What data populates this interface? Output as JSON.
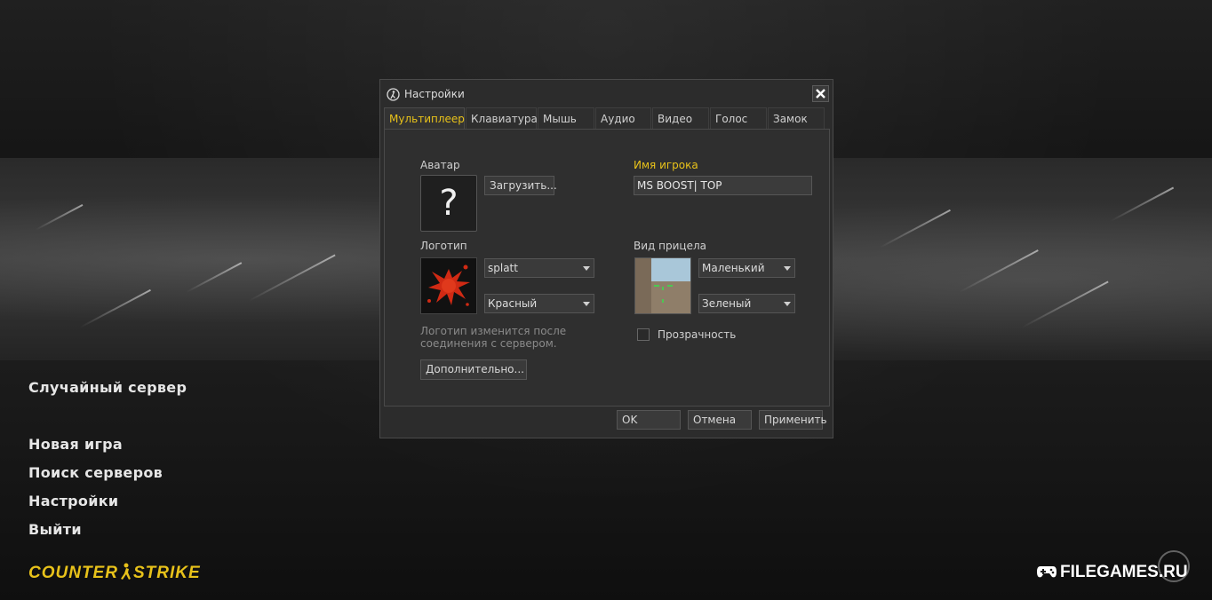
{
  "main_menu": {
    "items": [
      "Случайный сервер",
      "Новая игра",
      "Поиск серверов",
      "Настройки",
      "Выйти"
    ]
  },
  "branding": {
    "game_logo": "COUNTER-STRIKE",
    "watermark": "FILEGAMES.RU"
  },
  "dialog": {
    "title": "Настройки",
    "tabs": [
      "Мультиплеер",
      "Клавиатура",
      "Мышь",
      "Аудио",
      "Видео",
      "Голос",
      "Замок"
    ],
    "active_tab": "Мультиплеер",
    "avatar": {
      "label": "Аватар",
      "placeholder_glyph": "?",
      "upload_button": "Загрузить..."
    },
    "player_name": {
      "label": "Имя игрока",
      "value": "MS BOOST| TOP"
    },
    "logo": {
      "label": "Логотип",
      "selected_logo": "splatt",
      "selected_color": "Красный",
      "hint": "Логотип изменится после соединения с сервером.",
      "advanced_button": "Дополнительно..."
    },
    "crosshair": {
      "label": "Вид прицела",
      "size": "Маленький",
      "color": "Зеленый",
      "transparency_label": "Прозрачность",
      "transparency_checked": false
    },
    "footer": {
      "ok": "OK",
      "cancel": "Отмена",
      "apply": "Применить"
    }
  },
  "colors": {
    "accent": "#e8c21a",
    "spray": "#d02a14",
    "crosshair": "#36e04a"
  }
}
